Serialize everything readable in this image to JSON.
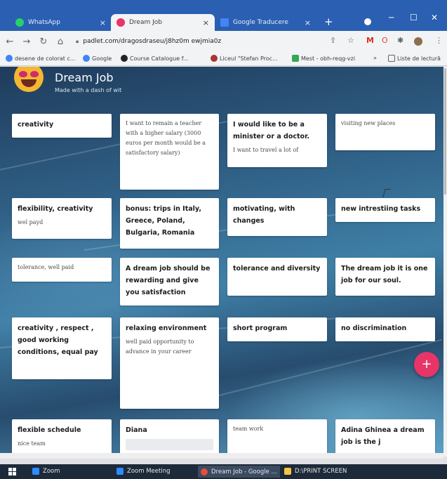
{
  "browser": {
    "tabs": [
      {
        "title": "WhatsApp",
        "color": "#25d366",
        "active": false
      },
      {
        "title": "Dream Job",
        "color": "#e73568",
        "active": true
      },
      {
        "title": "Google Traducere",
        "color": "#4285f4",
        "active": false
      }
    ],
    "new_tab": "+",
    "close_glyph": "×",
    "url": "padlet.com/dragosdraseu/j8hz0m ewjmia0z",
    "bookmarks": [
      "desene de colorat c...",
      "Google",
      "Course Catalogue f...",
      "Liceul \"Stefan Proc...",
      "Mest - obh-reqg-vzi",
      "»",
      "Liste de lectură"
    ]
  },
  "padlet": {
    "title": "Dream Job",
    "subtitle": "Made with a dash of wit",
    "fab_label": "+",
    "cards": [
      {
        "heading": "creativity",
        "body": ""
      },
      {
        "heading": "",
        "body": "I want to remain a teacher with a higher salary (3000 euros per month would be a satisfactory salary)"
      },
      {
        "heading": "I would like to be a minister or a doctor.",
        "body": "I want to travel a lot of"
      },
      {
        "heading": "",
        "body": "visiting new places"
      },
      {
        "heading": "flexibility, creativity",
        "body": "wel payd"
      },
      {
        "heading": "bonus: trips in Italy, Greece, Poland, Bulgaria, Romania",
        "body": ""
      },
      {
        "heading": "motivating, with changes",
        "body": ""
      },
      {
        "heading": "new intrestiing tasks",
        "body": ""
      },
      {
        "heading": "",
        "body": "tolerance, well paid"
      },
      {
        "heading": "A dream job should be rewarding and give you satisfaction",
        "body": ""
      },
      {
        "heading": "tolerance and diversity",
        "body": ""
      },
      {
        "heading": "The dream job it is one job for our soul.",
        "body": ""
      },
      {
        "heading": "creativity , respect , good working conditions, equal pay",
        "body": ""
      },
      {
        "heading": "relaxing environment",
        "body": "well paid opportunity to advance in your career"
      },
      {
        "heading": "short program",
        "body": ""
      },
      {
        "heading": "no discrimination",
        "body": ""
      },
      {
        "heading": "flexible schedule",
        "body": "nice team"
      },
      {
        "heading": "Diana",
        "body": ""
      },
      {
        "heading": "",
        "body": "team work"
      },
      {
        "heading": "Adina Ghinea a dream job is the j",
        "body": ""
      }
    ]
  },
  "taskbar": {
    "items": [
      "Zoom",
      "Zoom Meeting",
      "Dream Job - Google ...",
      "D:\\PRINT SCREEN"
    ]
  },
  "colors": {
    "accent": "#e73568",
    "chrome_blue": "#2a5fb2",
    "taskbar": "#1d2a3a"
  },
  "icons": [
    "back-arrow-icon",
    "forward-arrow-icon",
    "reload-icon",
    "home-icon",
    "lock-icon",
    "star-icon",
    "close-icon",
    "plus-icon",
    "windows-start-icon"
  ]
}
